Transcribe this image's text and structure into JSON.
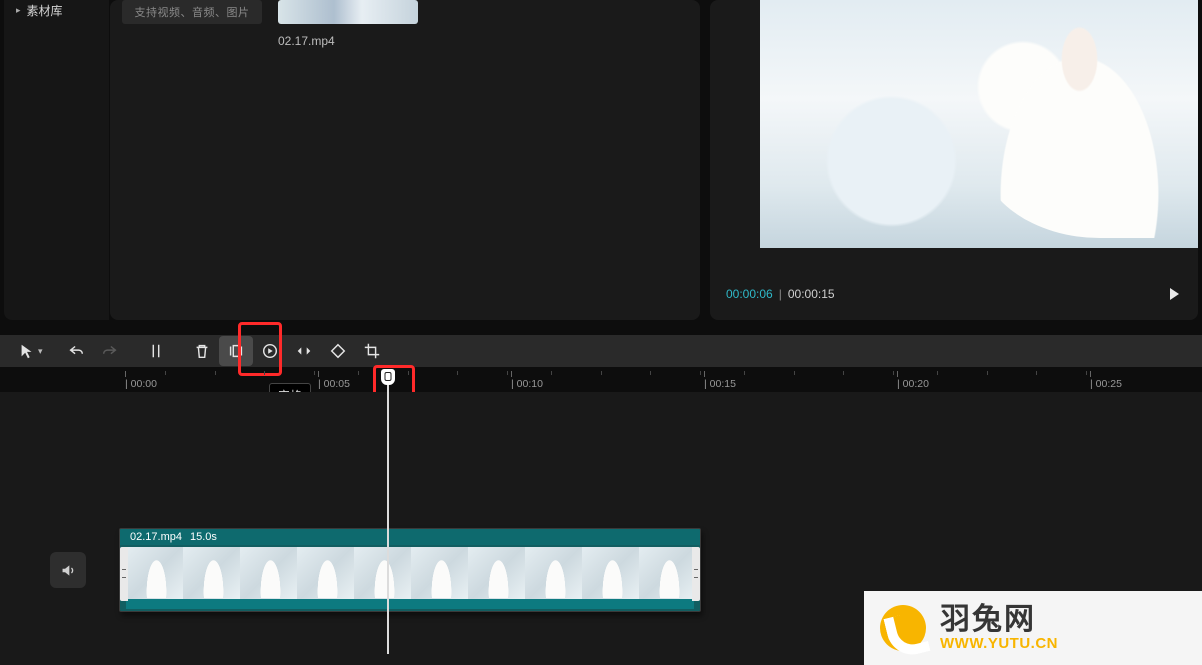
{
  "sidebar": {
    "library_label": "素材库"
  },
  "media": {
    "placeholder_hint": "支持视频、音频、图片",
    "clip_name": "02.17.mp4"
  },
  "preview": {
    "current_time": "00:00:06",
    "separator": "|",
    "total_time": "00:00:15"
  },
  "toolbar": {
    "freeze_tooltip": "定格"
  },
  "ruler": {
    "t0": "| 00:00",
    "t1": "| 00:05",
    "t2": "| 00:10",
    "t3": "| 00:15",
    "t4": "| 00:20",
    "t5": "| 00:25"
  },
  "clip": {
    "name": "02.17.mp4",
    "duration": "15.0s"
  },
  "watermark": {
    "name": "羽兔网",
    "url": "WWW.YUTU.CN"
  }
}
